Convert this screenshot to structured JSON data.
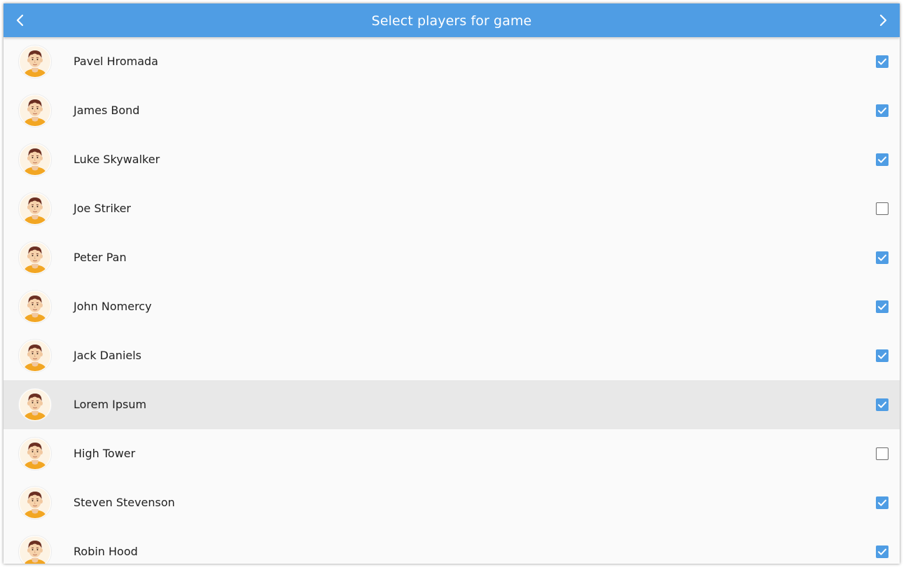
{
  "appbar": {
    "title": "Select players for game",
    "prev_icon": "chevron-left-icon",
    "next_icon": "chevron-right-icon",
    "color": "#4f9de4"
  },
  "players": [
    {
      "name": "Pavel Hromada",
      "selected": true
    },
    {
      "name": "James Bond",
      "selected": true
    },
    {
      "name": "Luke Skywalker",
      "selected": true
    },
    {
      "name": "Joe Striker",
      "selected": false
    },
    {
      "name": "Peter Pan",
      "selected": true
    },
    {
      "name": "John Nomercy",
      "selected": true
    },
    {
      "name": "Jack Daniels",
      "selected": true
    },
    {
      "name": "Lorem Ipsum",
      "selected": true,
      "highlighted": true
    },
    {
      "name": "High Tower",
      "selected": false
    },
    {
      "name": "Steven Stevenson",
      "selected": true
    },
    {
      "name": "Robin Hood",
      "selected": true
    }
  ],
  "colors": {
    "accent": "#4f9de4",
    "row_highlight": "#e8e8e8",
    "background": "#fafafa"
  }
}
